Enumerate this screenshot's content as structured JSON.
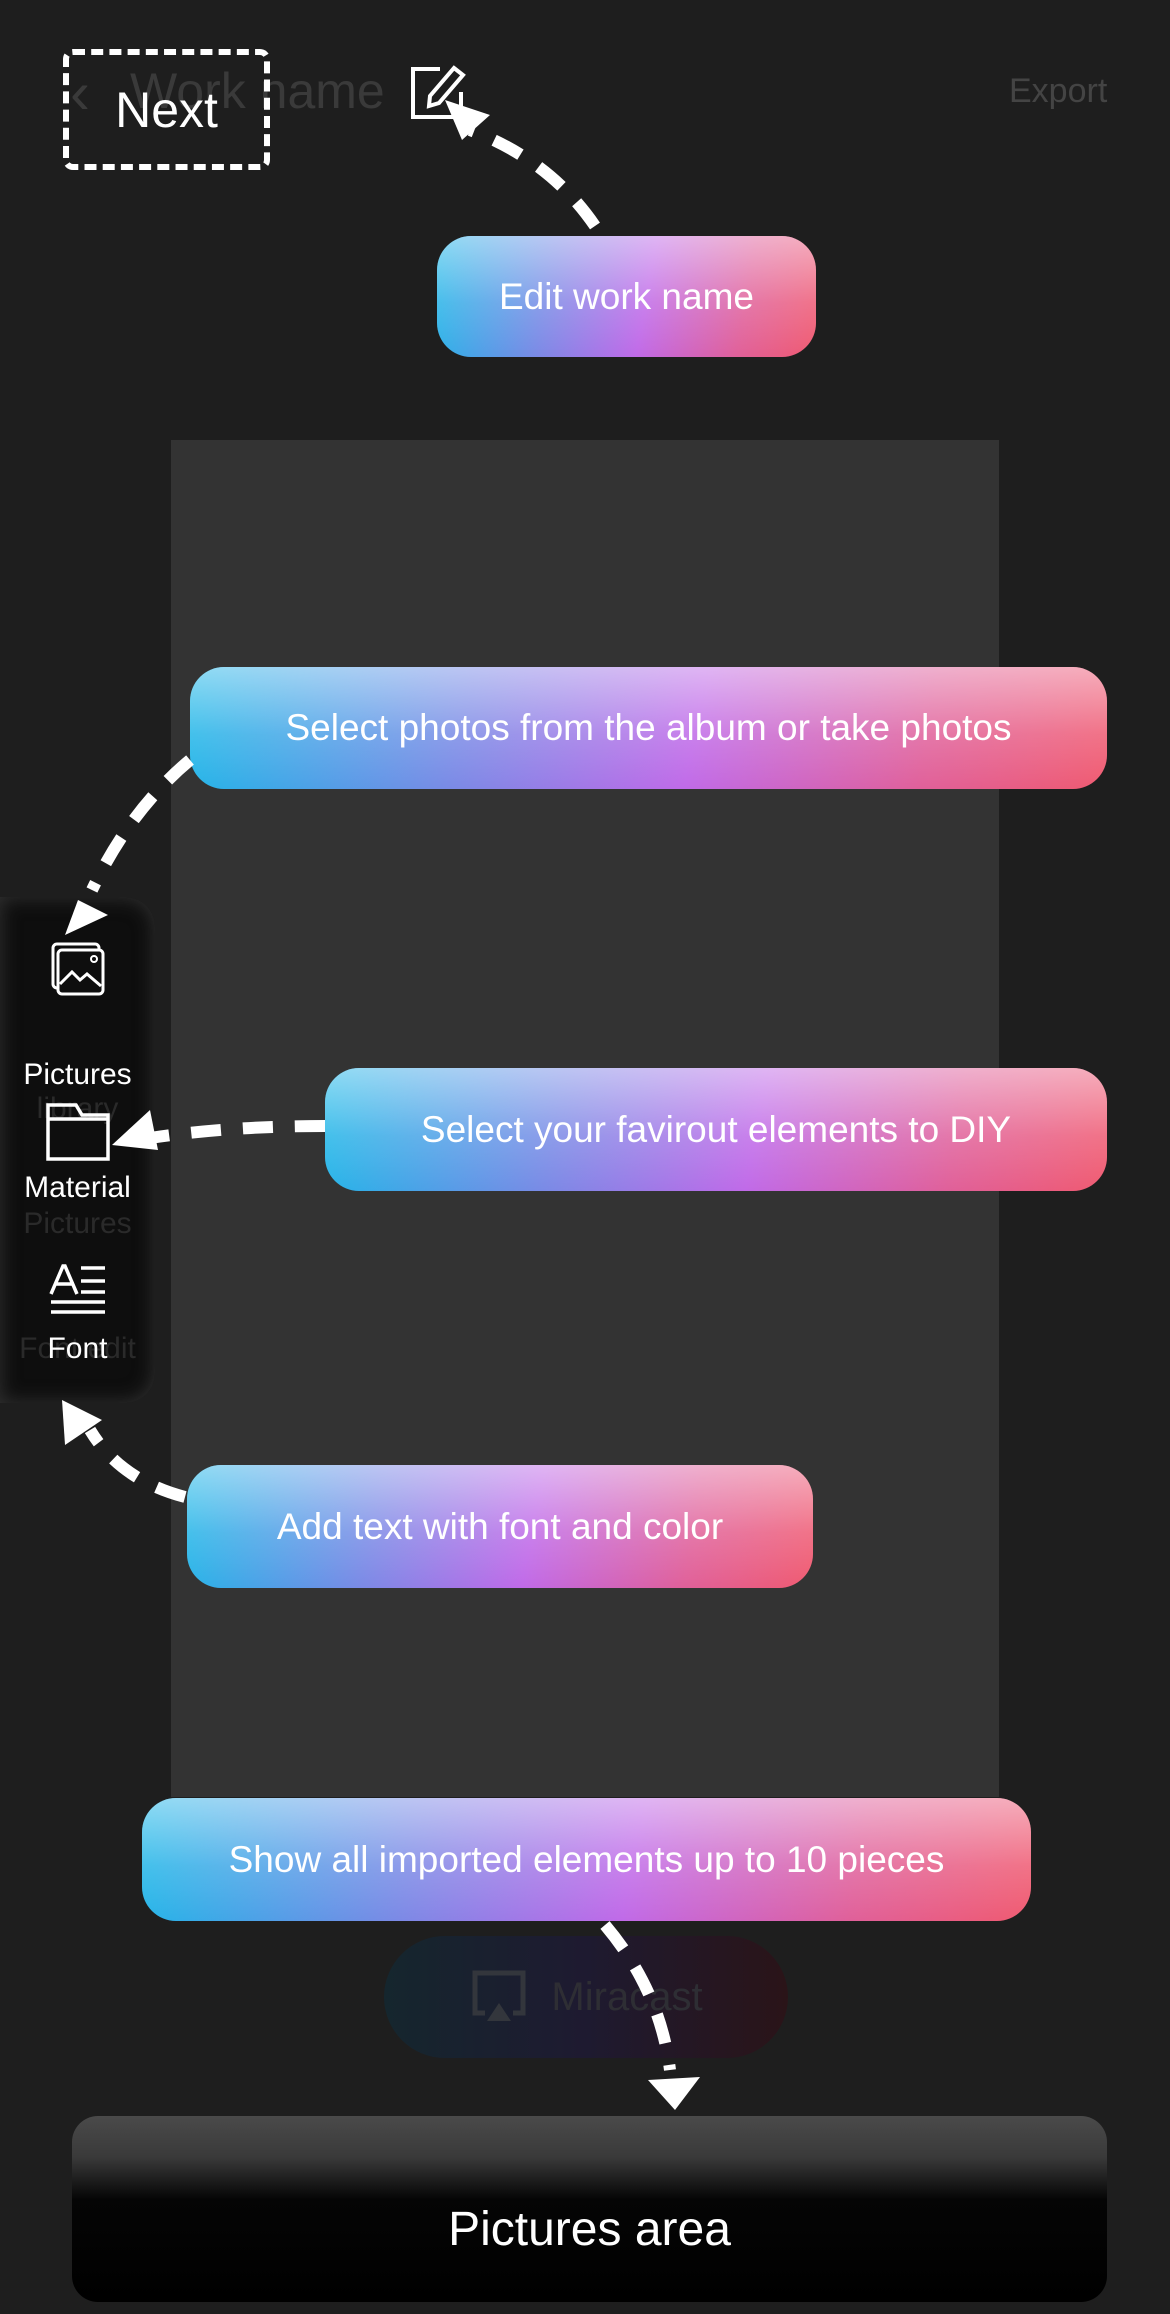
{
  "header": {
    "back_icon": "chevron-left-icon",
    "work_name": "Work name",
    "edit_icon": "edit-pencil-icon",
    "export_label": "Export"
  },
  "guide": {
    "next_label": "Next",
    "tips": [
      "Edit work name",
      "Select photos from the album or take photos",
      "Select your favirout elements to DIY",
      "Add text with font and color",
      "Show all imported elements up to 10 pieces"
    ],
    "pictures_area_label": "Pictures area"
  },
  "sidebar": {
    "items": [
      {
        "label": "Pictures",
        "ghost_label": "library",
        "icon": "pictures-icon"
      },
      {
        "label": "Material",
        "ghost_label": "Pictures",
        "icon": "folder-icon"
      },
      {
        "label": "Font",
        "ghost_label": "Font edit",
        "icon": "font-icon"
      }
    ]
  },
  "miracast": {
    "label": "Miracast",
    "icon": "cast-screen-icon"
  },
  "colors": {
    "background": "#1e1e1e",
    "canvas": "#333333",
    "gradient_start": "#1fb8e8",
    "gradient_mid": "#c06ae8",
    "gradient_end": "#f05a70"
  }
}
